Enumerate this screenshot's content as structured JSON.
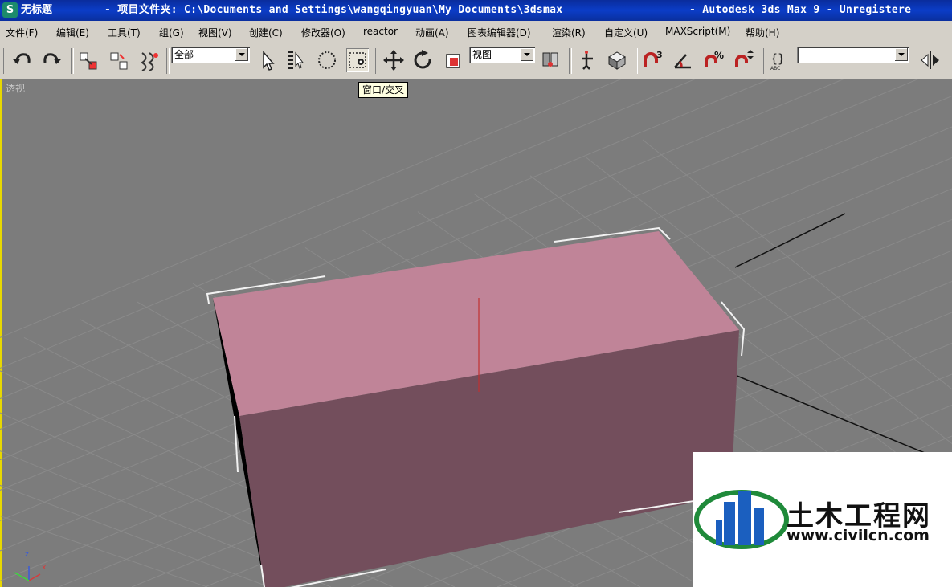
{
  "window": {
    "doc_title": "无标题",
    "project_path": "- 项目文件夹: C:\\Documents and Settings\\wangqingyuan\\My Documents\\3dsmax",
    "app_name": "- Autodesk 3ds Max 9  - Unregistere"
  },
  "menu": [
    "文件(F)",
    "编辑(E)",
    "工具(T)",
    "组(G)",
    "视图(V)",
    "创建(C)",
    "修改器(O)",
    "reactor",
    "动画(A)",
    "图表编辑器(D)",
    "渲染(R)",
    "自定义(U)",
    "MAXScript(M)",
    "帮助(H)"
  ],
  "toolbar": {
    "selection_filter": "全部",
    "reference_coord": "视图",
    "named_selection": "",
    "tooltip": "窗口/交叉",
    "snaps": [
      "3",
      "%"
    ]
  },
  "viewport": {
    "label": "透视",
    "box_top_color": "#c08498",
    "box_front_color": "#734e5c",
    "box_side_color": "#000000",
    "grid_color": "#8a8a8a",
    "axis": [
      "z",
      "x"
    ]
  },
  "watermark": {
    "name": "土木工程网",
    "url": "www.civilcn.com"
  }
}
